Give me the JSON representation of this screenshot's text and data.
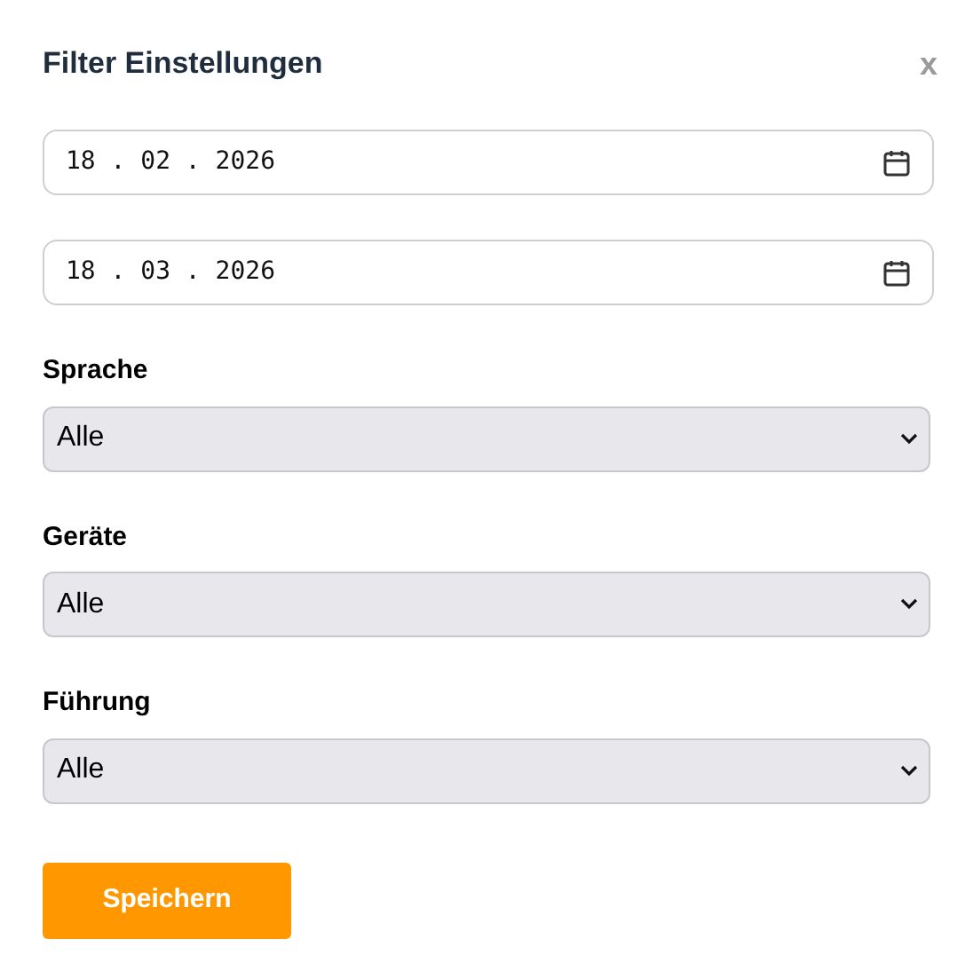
{
  "dialog": {
    "title": "Filter Einstellungen",
    "close": "x"
  },
  "dates": [
    {
      "value": "18 . 02 . 2026"
    },
    {
      "value": "18 . 03 . 2026"
    }
  ],
  "selects": [
    {
      "label": "Sprache",
      "value": "Alle"
    },
    {
      "label": "Geräte",
      "value": "Alle"
    },
    {
      "label": "Führung",
      "value": "Alle"
    }
  ],
  "save_button": "Speichern"
}
